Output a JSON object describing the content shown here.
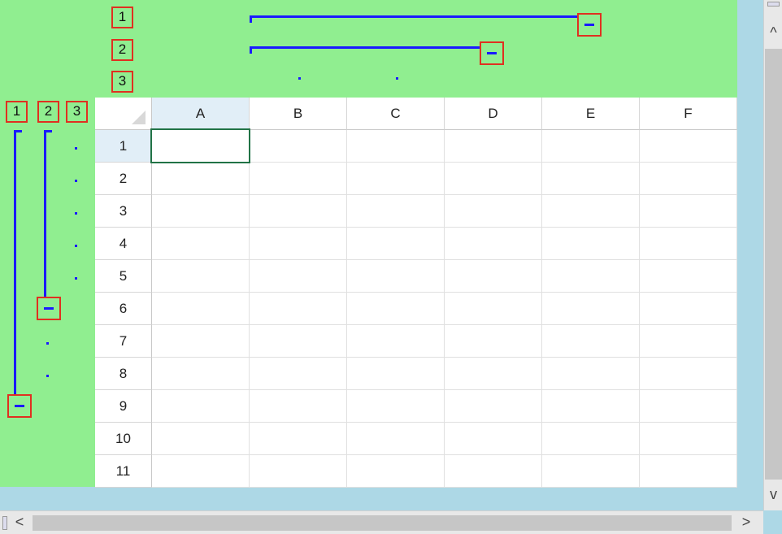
{
  "outline": {
    "column_level_buttons": [
      "1",
      "2",
      "3"
    ],
    "row_level_buttons": [
      "1",
      "2",
      "3"
    ],
    "collapse_symbol": "minus-icon"
  },
  "sheet": {
    "columns": [
      "A",
      "B",
      "C",
      "D",
      "E",
      "F"
    ],
    "rows": [
      "1",
      "2",
      "3",
      "4",
      "5",
      "6",
      "7",
      "8",
      "9",
      "10",
      "11"
    ],
    "active_cell": "A1"
  },
  "scrollbar": {
    "vertical_up": "^",
    "vertical_down": "v",
    "horizontal_left": "<",
    "horizontal_right": ">"
  },
  "colors": {
    "outline_background": "#90ee90",
    "outline_line": "#1a1aff",
    "button_border": "#e03020",
    "active_cell_border": "#217346",
    "frame": "#add8e6"
  }
}
